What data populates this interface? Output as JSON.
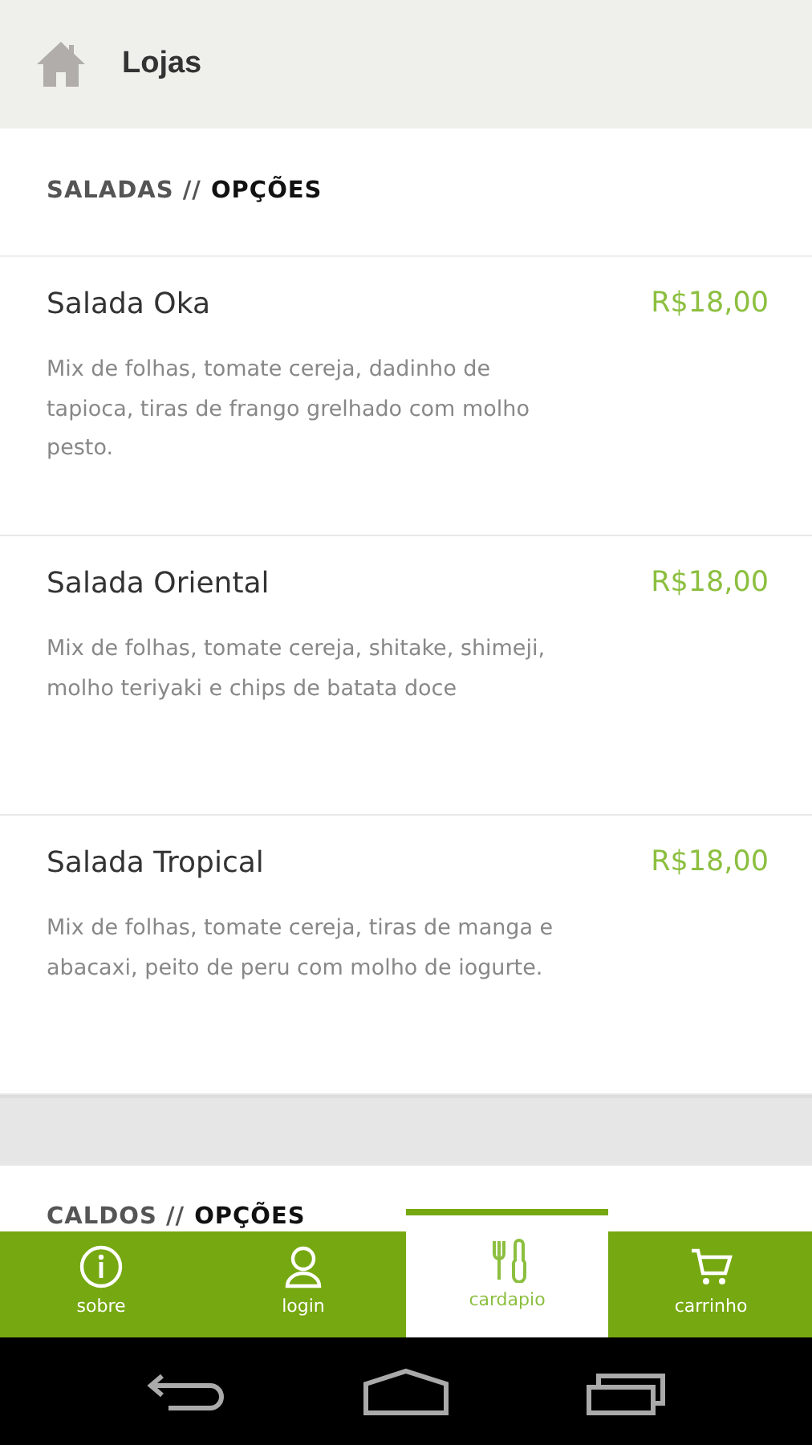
{
  "header": {
    "title": "Lojas"
  },
  "sections": [
    {
      "category": "SALADAS //",
      "label": "OPÇÕES",
      "items": [
        {
          "name": "Salada Oka",
          "price": "R$18,00",
          "description": "Mix de folhas, tomate cereja, dadinho de tapioca, tiras de frango grelhado com molho pesto."
        },
        {
          "name": "Salada Oriental",
          "price": "R$18,00",
          "description": "Mix de folhas, tomate cereja, shitake, shimeji, molho teriyaki e chips de batata doce"
        },
        {
          "name": "Salada Tropical",
          "price": "R$18,00",
          "description": "Mix de folhas, tomate cereja, tiras de manga e abacaxi, peito de peru com molho de iogurte."
        }
      ]
    },
    {
      "category": "CALDOS //",
      "label": "OPÇÕES"
    }
  ],
  "tabs": [
    {
      "label": "sobre",
      "kind": "info",
      "selected": false
    },
    {
      "label": "login",
      "kind": "user",
      "selected": false
    },
    {
      "label": "cardapio",
      "kind": "cutlery",
      "selected": true
    },
    {
      "label": "carrinho",
      "kind": "cart",
      "selected": false
    }
  ]
}
